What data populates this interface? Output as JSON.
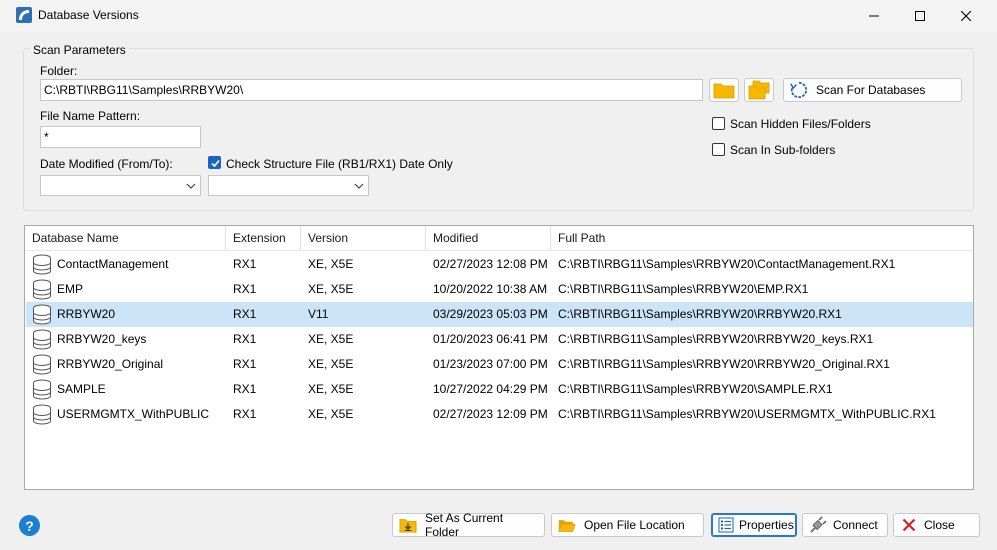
{
  "window": {
    "title": "Database Versions",
    "minimize_icon": "minimize-icon",
    "maximize_icon": "maximize-icon",
    "close_icon": "close-icon"
  },
  "scan_parameters": {
    "legend": "Scan Parameters",
    "folder_label": "Folder:",
    "folder_value": "C:\\RBTI\\RBG11\\Samples\\RRBYW20\\",
    "pattern_label": "File Name Pattern:",
    "pattern_value": "*",
    "date_label": "Date Modified (From/To):",
    "check_structure_label": "Check Structure File (RB1/RX1) Date Only",
    "check_structure_checked": true,
    "scan_button": "Scan For Databases",
    "hidden_label": "Scan Hidden Files/Folders",
    "hidden_checked": false,
    "subfolders_label": "Scan In Sub-folders",
    "subfolders_checked": false
  },
  "grid": {
    "columns": [
      "Database Name",
      "Extension",
      "Version",
      "Modified",
      "Full Path"
    ],
    "rows": [
      {
        "name": "ContactManagement",
        "ext": "RX1",
        "version": "XE, X5E",
        "modified": "02/27/2023 12:08 PM",
        "path": "C:\\RBTI\\RBG11\\Samples\\RRBYW20\\ContactManagement.RX1"
      },
      {
        "name": "EMP",
        "ext": "RX1",
        "version": "XE, X5E",
        "modified": "10/20/2022 10:38 AM",
        "path": "C:\\RBTI\\RBG11\\Samples\\RRBYW20\\EMP.RX1"
      },
      {
        "name": "RRBYW20",
        "ext": "RX1",
        "version": "V11",
        "modified": "03/29/2023 05:03 PM",
        "path": "C:\\RBTI\\RBG11\\Samples\\RRBYW20\\RRBYW20.RX1"
      },
      {
        "name": "RRBYW20_keys",
        "ext": "RX1",
        "version": "XE, X5E",
        "modified": "01/20/2023 06:41 PM",
        "path": "C:\\RBTI\\RBG11\\Samples\\RRBYW20\\RRBYW20_keys.RX1"
      },
      {
        "name": "RRBYW20_Original",
        "ext": "RX1",
        "version": "XE, X5E",
        "modified": "01/23/2023 07:00 PM",
        "path": "C:\\RBTI\\RBG11\\Samples\\RRBYW20\\RRBYW20_Original.RX1"
      },
      {
        "name": "SAMPLE",
        "ext": "RX1",
        "version": "XE, X5E",
        "modified": "10/27/2022 04:29 PM",
        "path": "C:\\RBTI\\RBG11\\Samples\\RRBYW20\\SAMPLE.RX1"
      },
      {
        "name": "USERMGMTX_WithPUBLIC",
        "ext": "RX1",
        "version": "XE, X5E",
        "modified": "02/27/2023 12:09 PM",
        "path": "C:\\RBTI\\RBG11\\Samples\\RRBYW20\\USERMGMTX_WithPUBLIC.RX1"
      }
    ],
    "selected_row_color": "#cce4f7"
  },
  "footer": {
    "help_label": "?",
    "set_current_folder": "Set As Current Folder",
    "open_file_location": "Open File Location",
    "properties": "Properties",
    "connect": "Connect",
    "close": "Close"
  },
  "colors": {
    "accent": "#1b63c6",
    "folder": "#f6b800",
    "close_red": "#d42323"
  }
}
